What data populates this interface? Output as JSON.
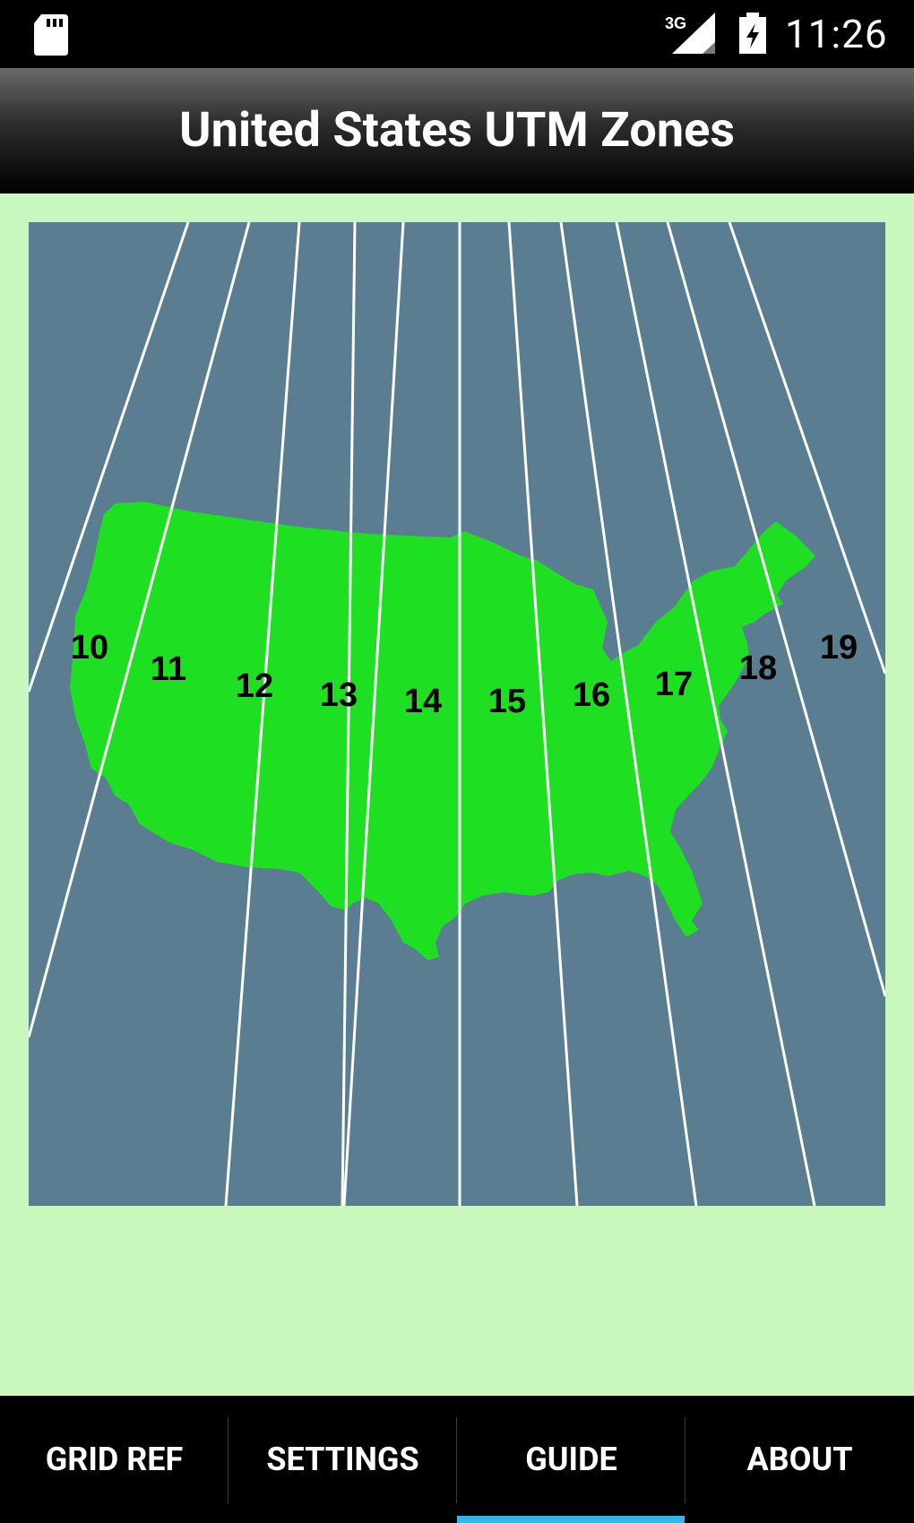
{
  "status_bar": {
    "network": "3G",
    "time": "11:26",
    "icons": [
      "sd-card-icon",
      "signal-3g-icon",
      "battery-charging-icon"
    ]
  },
  "action_bar": {
    "title": "United States UTM Zones"
  },
  "map": {
    "colors": {
      "ocean": "#5a7d91",
      "land": "#1fdf22",
      "zone_lines": "#ffffff",
      "labels": "#000000"
    },
    "zone_labels": [
      "10",
      "11",
      "12",
      "13",
      "14",
      "15",
      "16",
      "17",
      "18",
      "19"
    ]
  },
  "tabs": [
    {
      "label": "GRID REF",
      "selected": false
    },
    {
      "label": "SETTINGS",
      "selected": false
    },
    {
      "label": "GUIDE",
      "selected": true
    },
    {
      "label": "ABOUT",
      "selected": false
    }
  ],
  "accent_color": "#33b5e5"
}
